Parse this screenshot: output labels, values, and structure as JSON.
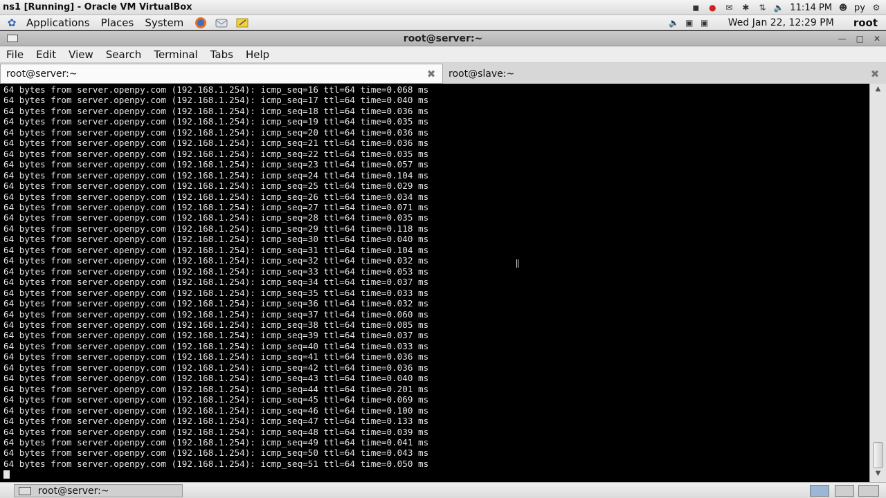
{
  "host": {
    "title": "ns1 [Running] - Oracle VM VirtualBox",
    "time": "11:14 PM",
    "user": "py"
  },
  "panel": {
    "menus": [
      "Applications",
      "Places",
      "System"
    ],
    "clock": "Wed Jan 22, 12:29 PM",
    "user": "root"
  },
  "window": {
    "title": "root@server:~"
  },
  "menubar": [
    "File",
    "Edit",
    "View",
    "Search",
    "Terminal",
    "Tabs",
    "Help"
  ],
  "tabs": [
    {
      "label": "root@server:~",
      "active": true
    },
    {
      "label": "root@slave:~",
      "active": false
    }
  ],
  "terminal": {
    "lines": [
      "64 bytes from server.openpy.com (192.168.1.254): icmp_seq=16 ttl=64 time=0.068 ms",
      "64 bytes from server.openpy.com (192.168.1.254): icmp_seq=17 ttl=64 time=0.040 ms",
      "64 bytes from server.openpy.com (192.168.1.254): icmp_seq=18 ttl=64 time=0.036 ms",
      "64 bytes from server.openpy.com (192.168.1.254): icmp_seq=19 ttl=64 time=0.035 ms",
      "64 bytes from server.openpy.com (192.168.1.254): icmp_seq=20 ttl=64 time=0.036 ms",
      "64 bytes from server.openpy.com (192.168.1.254): icmp_seq=21 ttl=64 time=0.036 ms",
      "64 bytes from server.openpy.com (192.168.1.254): icmp_seq=22 ttl=64 time=0.035 ms",
      "64 bytes from server.openpy.com (192.168.1.254): icmp_seq=23 ttl=64 time=0.057 ms",
      "64 bytes from server.openpy.com (192.168.1.254): icmp_seq=24 ttl=64 time=0.104 ms",
      "64 bytes from server.openpy.com (192.168.1.254): icmp_seq=25 ttl=64 time=0.029 ms",
      "64 bytes from server.openpy.com (192.168.1.254): icmp_seq=26 ttl=64 time=0.034 ms",
      "64 bytes from server.openpy.com (192.168.1.254): icmp_seq=27 ttl=64 time=0.071 ms",
      "64 bytes from server.openpy.com (192.168.1.254): icmp_seq=28 ttl=64 time=0.035 ms",
      "64 bytes from server.openpy.com (192.168.1.254): icmp_seq=29 ttl=64 time=0.118 ms",
      "64 bytes from server.openpy.com (192.168.1.254): icmp_seq=30 ttl=64 time=0.040 ms",
      "64 bytes from server.openpy.com (192.168.1.254): icmp_seq=31 ttl=64 time=0.104 ms",
      "64 bytes from server.openpy.com (192.168.1.254): icmp_seq=32 ttl=64 time=0.032 ms",
      "64 bytes from server.openpy.com (192.168.1.254): icmp_seq=33 ttl=64 time=0.053 ms",
      "64 bytes from server.openpy.com (192.168.1.254): icmp_seq=34 ttl=64 time=0.037 ms",
      "64 bytes from server.openpy.com (192.168.1.254): icmp_seq=35 ttl=64 time=0.033 ms",
      "64 bytes from server.openpy.com (192.168.1.254): icmp_seq=36 ttl=64 time=0.032 ms",
      "64 bytes from server.openpy.com (192.168.1.254): icmp_seq=37 ttl=64 time=0.060 ms",
      "64 bytes from server.openpy.com (192.168.1.254): icmp_seq=38 ttl=64 time=0.085 ms",
      "64 bytes from server.openpy.com (192.168.1.254): icmp_seq=39 ttl=64 time=0.037 ms",
      "64 bytes from server.openpy.com (192.168.1.254): icmp_seq=40 ttl=64 time=0.033 ms",
      "64 bytes from server.openpy.com (192.168.1.254): icmp_seq=41 ttl=64 time=0.036 ms",
      "64 bytes from server.openpy.com (192.168.1.254): icmp_seq=42 ttl=64 time=0.036 ms",
      "64 bytes from server.openpy.com (192.168.1.254): icmp_seq=43 ttl=64 time=0.040 ms",
      "64 bytes from server.openpy.com (192.168.1.254): icmp_seq=44 ttl=64 time=0.201 ms",
      "64 bytes from server.openpy.com (192.168.1.254): icmp_seq=45 ttl=64 time=0.069 ms",
      "64 bytes from server.openpy.com (192.168.1.254): icmp_seq=46 ttl=64 time=0.100 ms",
      "64 bytes from server.openpy.com (192.168.1.254): icmp_seq=47 ttl=64 time=0.133 ms",
      "64 bytes from server.openpy.com (192.168.1.254): icmp_seq=48 ttl=64 time=0.039 ms",
      "64 bytes from server.openpy.com (192.168.1.254): icmp_seq=49 ttl=64 time=0.041 ms",
      "64 bytes from server.openpy.com (192.168.1.254): icmp_seq=50 ttl=64 time=0.043 ms",
      "64 bytes from server.openpy.com (192.168.1.254): icmp_seq=51 ttl=64 time=0.050 ms"
    ]
  },
  "taskbar": {
    "window_label": "root@server:~"
  },
  "colors": {
    "terminal_bg": "#000000",
    "terminal_fg": "#e6e6e6",
    "workspace_active": "#9cb7d6"
  }
}
